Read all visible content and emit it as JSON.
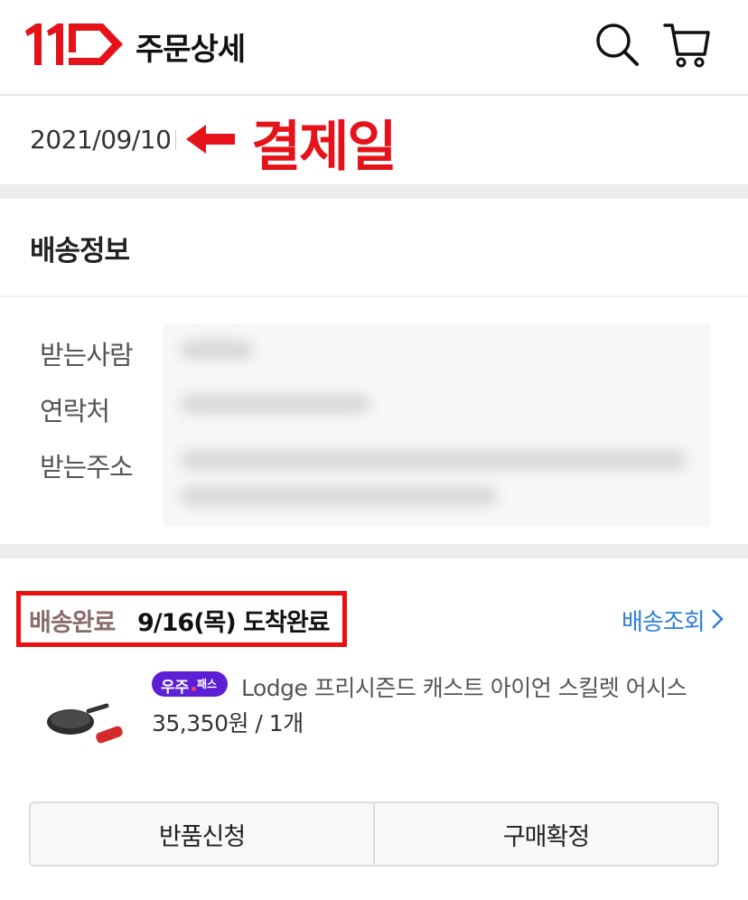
{
  "header": {
    "title": "주문상세",
    "logo_text": "11",
    "search_icon": "search-icon",
    "cart_icon": "cart-icon"
  },
  "order": {
    "date": "2021/09/10",
    "annotation": "결제일"
  },
  "delivery_info": {
    "title": "배송정보",
    "labels": [
      "받는사람",
      "연락처",
      "받는주소"
    ]
  },
  "shipment": {
    "status": "배송완료",
    "arrival": "9/16(목) 도착완료",
    "track_label": "배송조회"
  },
  "product": {
    "badge_main": "우주",
    "badge_sub": "패스",
    "name": "Lodge 프리시즌드 캐스트 아이언 스킬렛 어시스",
    "price_qty": "35,350원 / 1개"
  },
  "actions": {
    "return_label": "반품신청",
    "confirm_label": "구매확정"
  },
  "colors": {
    "brand_red": "#e5121a",
    "link_blue": "#2f7ed8",
    "badge_purple": "#5c1fd6"
  }
}
